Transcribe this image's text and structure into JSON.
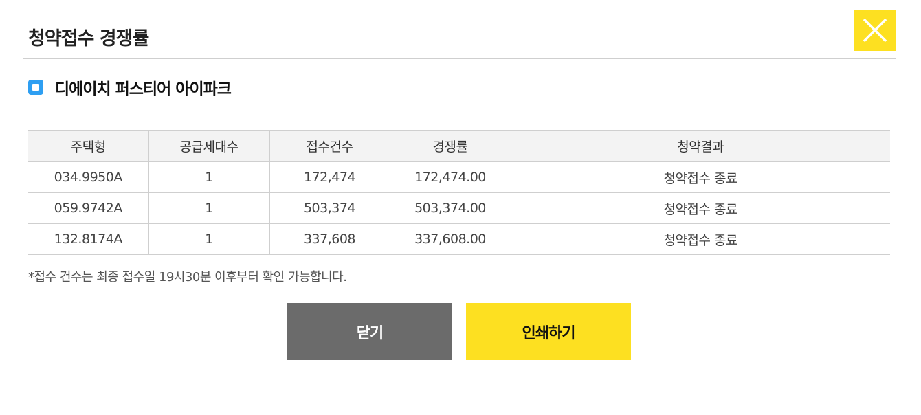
{
  "dialog": {
    "title": "청약접수 경쟁률",
    "close_icon": "close-x-icon"
  },
  "complex": {
    "bullet_icon": "square-bullet-icon",
    "name": "디에이치 퍼스티어 아이파크"
  },
  "table": {
    "headers": [
      "주택형",
      "공급세대수",
      "접수건수",
      "경쟁률",
      "청약결과"
    ],
    "rows": [
      [
        "034.9950A",
        "1",
        "172,474",
        "172,474.00",
        "청약접수 종료"
      ],
      [
        "059.9742A",
        "1",
        "503,374",
        "503,374.00",
        "청약접수 종료"
      ],
      [
        "132.8174A",
        "1",
        "337,608",
        "337,608.00",
        "청약접수 종료"
      ]
    ]
  },
  "note": "*접수 건수는 최종 접수일 19시30분 이후부터 확인 가능합니다.",
  "buttons": {
    "close_label": "닫기",
    "print_label": "인쇄하기"
  },
  "colors": {
    "accent_yellow": "#fde021",
    "bullet_blue": "#2e9ff2",
    "close_button_gray": "#6b6b6b"
  }
}
